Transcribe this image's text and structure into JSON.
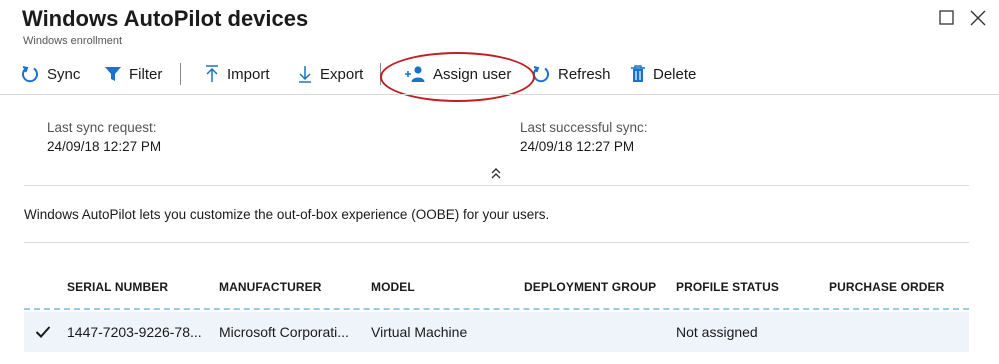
{
  "header": {
    "title": "Windows AutoPilot devices",
    "subtitle": "Windows enrollment"
  },
  "toolbar": {
    "sync": "Sync",
    "filter": "Filter",
    "import": "Import",
    "export": "Export",
    "assign_user": "Assign user",
    "refresh": "Refresh",
    "delete": "Delete"
  },
  "sync_info": {
    "last_request_label": "Last sync request:",
    "last_request_value": "24/09/18 12:27 PM",
    "last_success_label": "Last successful sync:",
    "last_success_value": "24/09/18 12:27 PM"
  },
  "description": "Windows AutoPilot lets you customize the out-of-box experience (OOBE) for your users.",
  "table": {
    "columns": [
      "SERIAL NUMBER",
      "MANUFACTURER",
      "MODEL",
      "DEPLOYMENT GROUP",
      "PROFILE STATUS",
      "PURCHASE ORDER"
    ],
    "rows": [
      {
        "checked": true,
        "cells": [
          "1447-7203-9226-78...",
          "Microsoft Corporati...",
          "Virtual Machine",
          "",
          "Not assigned",
          ""
        ]
      }
    ]
  },
  "colors": {
    "accent": "#1a73c8",
    "highlight": "#c01d24",
    "row_selected": "#eef4f9"
  },
  "icons": {
    "sync": "sync-icon",
    "filter": "filter-icon",
    "import": "import-icon",
    "export": "export-icon",
    "assign_user": "assign-user-icon",
    "refresh": "refresh-icon",
    "delete": "trash-icon",
    "maximize": "maximize-icon",
    "close": "close-icon",
    "collapse": "chevron-double-up-icon",
    "check": "checkmark-icon"
  }
}
